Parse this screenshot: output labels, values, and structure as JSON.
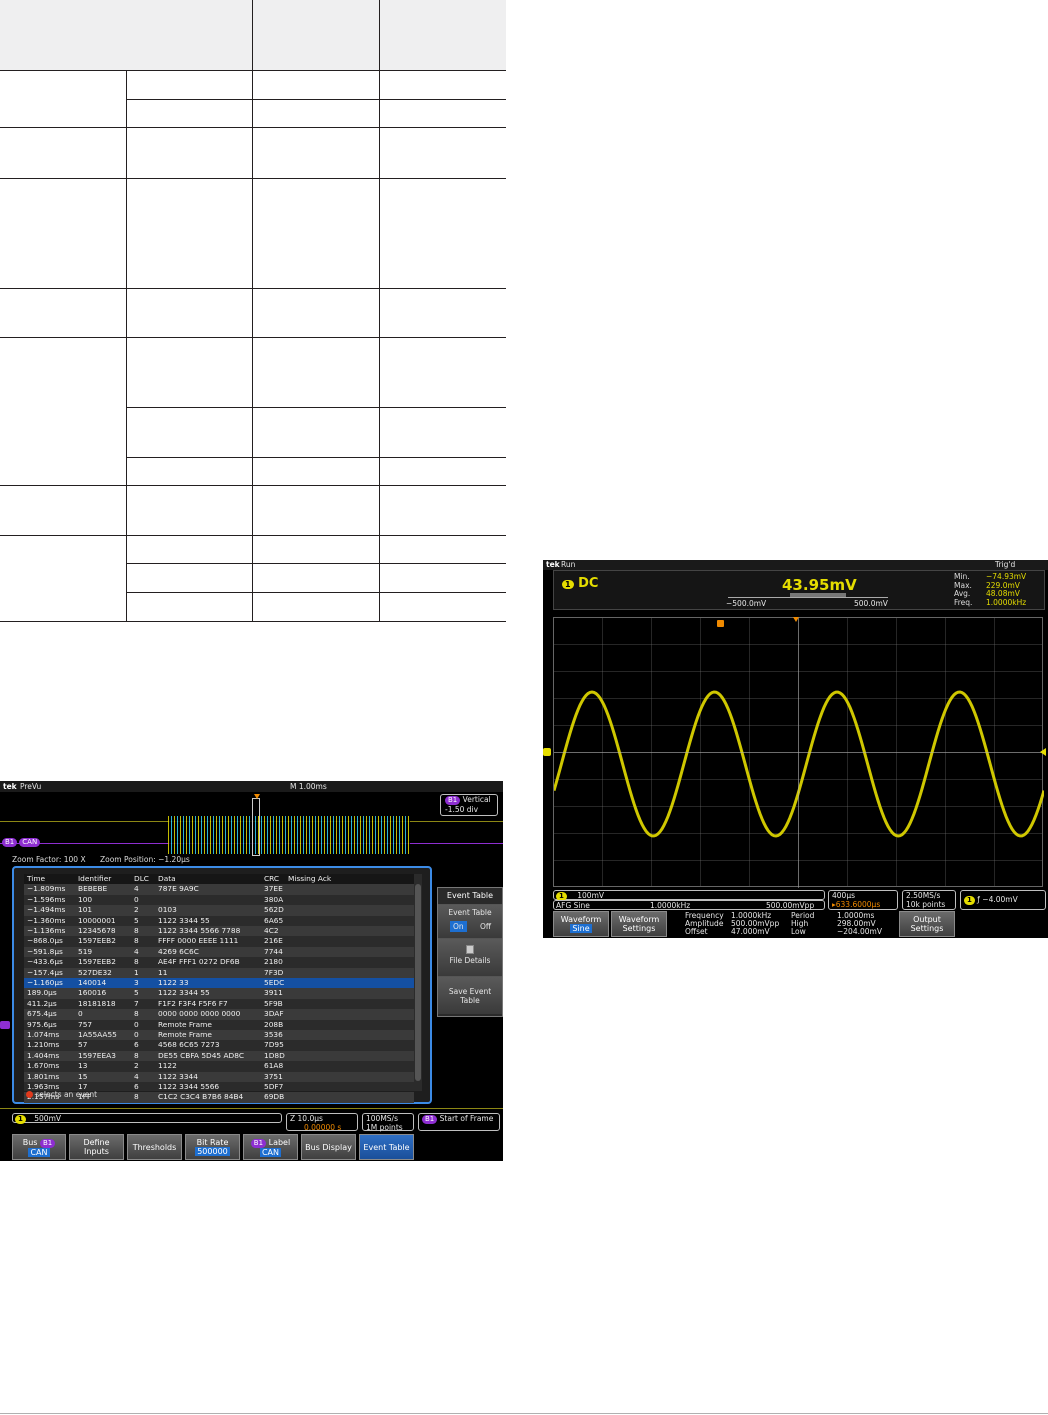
{
  "spec_table": {
    "header_cells": [
      "",
      "",
      ""
    ],
    "groups": [
      {
        "rows": 2,
        "heights": [
          29,
          28
        ]
      },
      {
        "rows": 1,
        "heights": [
          51
        ]
      },
      {
        "rows": 1,
        "heights": [
          110
        ]
      },
      {
        "rows": 1,
        "heights": [
          49
        ]
      },
      {
        "rows": 3,
        "heights": [
          70,
          50,
          28
        ]
      },
      {
        "rows": 1,
        "heights": [
          50
        ]
      },
      {
        "rows": 3,
        "heights": [
          28,
          29,
          29
        ]
      }
    ]
  },
  "scope_bus": {
    "logo": "tek",
    "status": "PreVu",
    "timebase": "M 1.00ms",
    "vertical_badge": "B1",
    "vertical_label": "Vertical",
    "vertical_value": "-1.50 div",
    "bus_badge": "B1",
    "bus_label": "CAN",
    "zoom_factor": "Zoom Factor: 100 X",
    "zoom_position": "Zoom Position: −1.20µs",
    "table": {
      "headers": [
        "Time",
        "Identifier",
        "DLC",
        "Data",
        "CRC",
        "Missing Ack"
      ],
      "selected_index": 10,
      "rows": [
        [
          "−1.809ms",
          "BEBEBE",
          "4",
          "787E 9A9C",
          "37EE"
        ],
        [
          "−1.596ms",
          "100",
          "0",
          "",
          "380A"
        ],
        [
          "−1.494ms",
          "101",
          "2",
          "0103",
          "562D"
        ],
        [
          "−1.360ms",
          "10000001",
          "5",
          "1122 3344 55",
          "6A65"
        ],
        [
          "−1.136ms",
          "12345678",
          "8",
          "1122 3344 5566 7788",
          "4C2"
        ],
        [
          "−868.0µs",
          "1597EEB2",
          "8",
          "FFFF 0000 EEEE 1111",
          "216E"
        ],
        [
          "−591.8µs",
          "519",
          "4",
          "4269 6C6C",
          "7744"
        ],
        [
          "−433.6µs",
          "1597EEB2",
          "8",
          "AE4F FFF1 0272 DF6B",
          "2180"
        ],
        [
          "−157.4µs",
          "527DE32",
          "1",
          "11",
          "7F3D"
        ],
        [
          "−1.160µs",
          "140014",
          "3",
          "1122 33",
          "5EDC"
        ],
        [
          "189.0µs",
          "160016",
          "5",
          "1122 3344 55",
          "3911"
        ],
        [
          "411.2µs",
          "18181818",
          "7",
          "F1F2 F3F4 F5F6 F7",
          "5F9B"
        ],
        [
          "675.4µs",
          "0",
          "8",
          "0000 0000 0000 0000",
          "3DAF"
        ],
        [
          "975.6µs",
          "757",
          "0",
          "Remote Frame",
          "208B"
        ],
        [
          "1.074ms",
          "1A55AA55",
          "0",
          "Remote Frame",
          "3536"
        ],
        [
          "1.210ms",
          "57",
          "6",
          "4568 6C65 7273",
          "7D95"
        ],
        [
          "1.404ms",
          "1597EEA3",
          "8",
          "DE55 CBFA 5D45 AD8C",
          "1D8D"
        ],
        [
          "1.670ms",
          "13",
          "2",
          "1122",
          "61A8"
        ],
        [
          "1.801ms",
          "15",
          "4",
          "1122 3344",
          "3751"
        ],
        [
          "1.963ms",
          "17",
          "6",
          "1122 3344 5566",
          "5DF7"
        ],
        [
          "2.157ms",
          "1FF",
          "8",
          "C1C2 C3C4 B7B6 84B4",
          "69DB"
        ]
      ]
    },
    "hint": "selects an event",
    "side_title": "Event Table",
    "side_event_table": "Event Table",
    "toggle_on": "On",
    "toggle_off": "Off",
    "file_details": "File Details",
    "save_event_table": "Save Event Table",
    "ch1_badge": "1",
    "ch1_scale": "500mV",
    "zoom_scale": "Z 10.0µs",
    "zoom_offset": "0.00000 s",
    "sample_rate": "100MS/s",
    "record_length": "1M points",
    "trigger_badge": "B1",
    "trigger_type": "Start of Frame",
    "buttons": [
      {
        "top": "Bus",
        "badge": "B1",
        "sub": "CAN"
      },
      {
        "top": "Define",
        "top2": "Inputs"
      },
      {
        "top": "Thresholds"
      },
      {
        "top": "Bit Rate",
        "sub": "500000"
      },
      {
        "top": "Label",
        "badge": "B1",
        "sub": "CAN"
      },
      {
        "top": "Bus Display"
      },
      {
        "top": "Event Table",
        "active": true
      }
    ],
    "colors": {
      "ch1": "#e5dd00",
      "bus": "#8e2ed1",
      "cyan": "#2fd4ff",
      "panel_border": "#3c8be6"
    }
  },
  "scope_afg": {
    "logo": "tek",
    "status": "Run",
    "trig_status": "Trig'd",
    "ch_badge": "1",
    "coupling": "DC",
    "readout": "43.95mV",
    "range_min": "−500.0mV",
    "range_max": "500.0mV",
    "stats": [
      {
        "label": "Min.",
        "value": "−74.93mV"
      },
      {
        "label": "Max.",
        "value": "229.0mV"
      },
      {
        "label": "Avg.",
        "value": "48.08mV"
      },
      {
        "label": "Freq.",
        "value": "1.0000kHz"
      }
    ],
    "ch1_scale": "100mV",
    "afg_label": "AFG",
    "afg_wave": "Sine",
    "afg_freq": "1.0000kHz",
    "afg_amp": "500.00mVpp",
    "timebase": "400µs",
    "trigger_pos": "633.6000µs",
    "sample_rate": "2.50MS/s",
    "record_length": "10k points",
    "trigger_level": "−4.00mV",
    "btn_waveform": "Waveform",
    "btn_waveform_sub": "Sine",
    "btn_waveform_settings": "Waveform Settings",
    "params": [
      {
        "label": "Frequency",
        "value": "1.0000kHz"
      },
      {
        "label": "Amplitude",
        "value": "500.00mVpp"
      },
      {
        "label": "Offset",
        "value": "47.000mV"
      }
    ],
    "params2": [
      {
        "label": "Period",
        "value": "1.0000ms"
      },
      {
        "label": "High",
        "value": "298.00mV"
      },
      {
        "label": "Low",
        "value": "−204.00mV"
      }
    ],
    "btn_output": "Output Settings",
    "colors": {
      "trace": "#e5dd00",
      "trigger": "#f08a00"
    }
  }
}
